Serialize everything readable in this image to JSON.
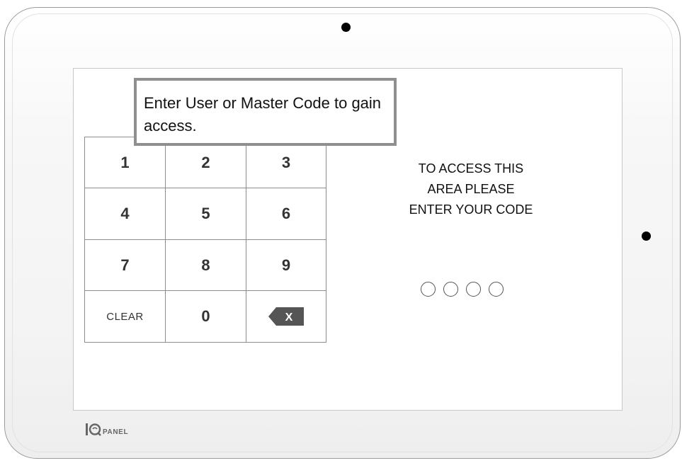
{
  "tooltip": {
    "text": "Enter User or Master Code to gain access."
  },
  "keypad": {
    "keys": [
      "1",
      "2",
      "3",
      "4",
      "5",
      "6",
      "7",
      "8",
      "9",
      "CLEAR",
      "0"
    ],
    "backspace_glyph": "X"
  },
  "message": {
    "lines": [
      "TO ACCESS THIS",
      "AREA PLEASE",
      "ENTER YOUR CODE"
    ]
  },
  "code_entry": {
    "digits_total": 4,
    "digits_entered": 0
  },
  "brand": {
    "logo_text": "PANEL"
  },
  "colors": {
    "device_border": "#9a9a9a",
    "keypad_border": "#8c8c8c",
    "tooltip_border": "#8f8f8f",
    "backspace_fill": "#555555"
  }
}
